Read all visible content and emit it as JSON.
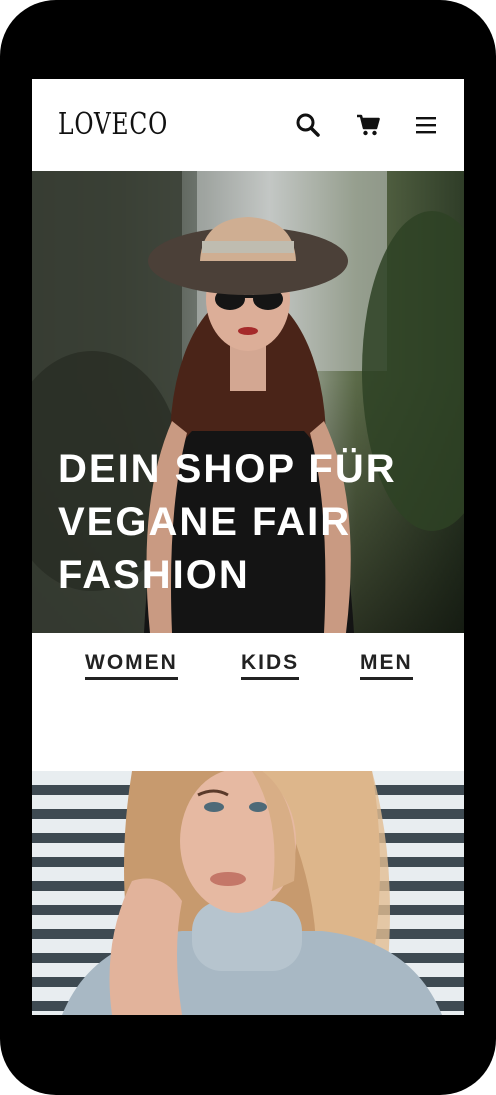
{
  "header": {
    "logo": "LOVECO",
    "icons": [
      "search-icon",
      "cart-icon",
      "menu-icon"
    ]
  },
  "hero": {
    "title_lines": [
      "DEIN SHOP FÜR",
      "VEGANE FAIR",
      "FASHION"
    ]
  },
  "categories": [
    {
      "label": "WOMEN"
    },
    {
      "label": "KIDS"
    },
    {
      "label": "MEN"
    }
  ],
  "colors": {
    "frame": "#000000",
    "background": "#ffffff",
    "text": "#222222",
    "hero_text": "#ffffff"
  }
}
